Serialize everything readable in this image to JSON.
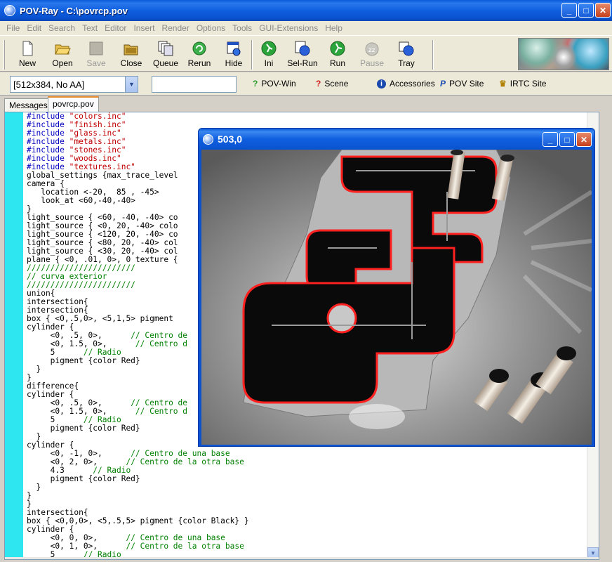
{
  "window": {
    "title": "POV-Ray - C:\\povrcp.pov",
    "buttons": [
      "_",
      "□",
      "✕"
    ]
  },
  "menu": [
    "File",
    "Edit",
    "Search",
    "Text",
    "Editor",
    "Insert",
    "Render",
    "Options",
    "Tools",
    "GUI-Extensions",
    "Help"
  ],
  "toolbar": {
    "new": "New",
    "open": "Open",
    "save": "Save",
    "close": "Close",
    "queue": "Queue",
    "rerun": "Rerun",
    "hide": "Hide",
    "ini": "Ini",
    "selrun": "Sel-Run",
    "run": "Run",
    "pause": "Pause",
    "tray": "Tray"
  },
  "toolbar2": {
    "resolution": "[512x384, No AA]",
    "command": "",
    "povwin": "POV-Win",
    "scene": "Scene",
    "accessories": "Accessories",
    "povsite": "POV Site",
    "irtc": "IRTC Site"
  },
  "tabs": [
    "Messages",
    "povrcp.pov"
  ],
  "render_window": {
    "title": "503,0"
  },
  "code_lines": [
    "#include \"colors.inc\"",
    "#include \"finish.inc\"",
    "#include \"glass.inc\"",
    "#include \"metals.inc\"",
    "#include \"stones.inc\"",
    "#include \"woods.inc\"",
    "#include \"textures.inc\"",
    "global_settings {max_trace_level",
    "camera {",
    "   location <-20,  85 , -45>",
    "   look_at <60,-40,-40>",
    "}",
    "light_source { <60, -40, -40> co",
    "light_source { <0, 20, -40> colo",
    "light_source { <120, 20, -40> co",
    "light_source { <80, 20, -40> col",
    "light_source { <30, 20, -40> col",
    "plane { <0, .01, 0>, 0 texture {",
    "///////////////////////",
    "// curva exterior",
    "///////////////////////",
    "union{",
    "intersection{",
    "intersection{",
    "box { <0,.5,0>, <5,1,5> pigment",
    "cylinder {",
    "     <0, .5, 0>,      // Centro de",
    "     <0, 1.5, 0>,      // Centro d",
    "     5      // Radio",
    "     pigment {color Red}",
    "  }",
    "}",
    "difference{",
    "cylinder {",
    "     <0, .5, 0>,      // Centro de",
    "     <0, 1.5, 0>,      // Centro d",
    "     5      // Radio",
    "     pigment {color Red}",
    "  }",
    "cylinder {",
    "     <0, -1, 0>,      // Centro de una base",
    "     <0, 2, 0>,      // Centro de la otra base",
    "     4.3      // Radio",
    "     pigment {color Red}",
    "  }",
    "}",
    "}",
    "intersection{",
    "box { <0,0,0>, <5,.5,5> pigment {color Black} }",
    "cylinder {",
    "     <0, 0, 0>,      // Centro de una base",
    "     <0, 1, 0>,      // Centro de la otra base",
    "     5      // Radio"
  ],
  "colors": {
    "titlebar": "#0a52cf",
    "gutter": "#2ee6ef",
    "string": "#c00000",
    "comment": "#008000",
    "keyword": "#0000c0"
  }
}
